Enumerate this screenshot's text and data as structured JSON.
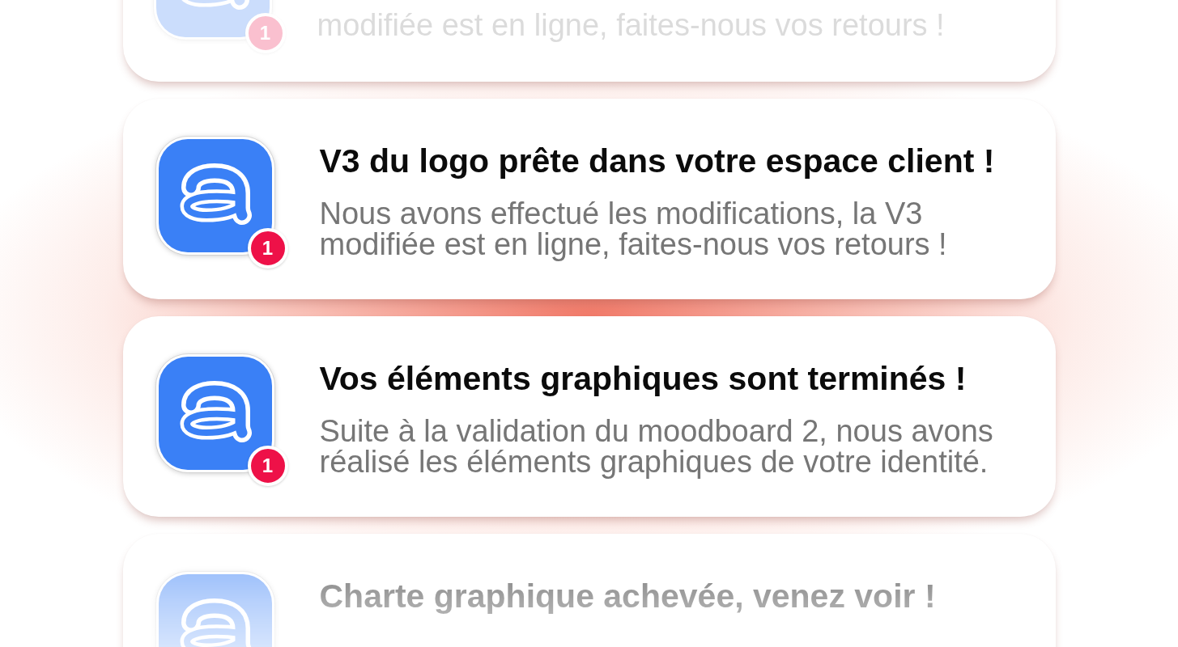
{
  "notifications": [
    {
      "body": "modifiée est en ligne, faites-nous vos retours !",
      "badge": "1"
    },
    {
      "title": "V3 du logo prête dans votre espace client !",
      "body": "Nous avons effectué les modifications, la V3 modifiée est en ligne, faites-nous vos retours !",
      "badge": "1"
    },
    {
      "title": "Vos éléments graphiques sont terminés !",
      "body": "Suite à la validation du moodboard 2, nous avons réalisé les éléments graphiques de votre identité.",
      "badge": "1"
    },
    {
      "title": "Charte graphique achevée, venez voir !"
    }
  ]
}
